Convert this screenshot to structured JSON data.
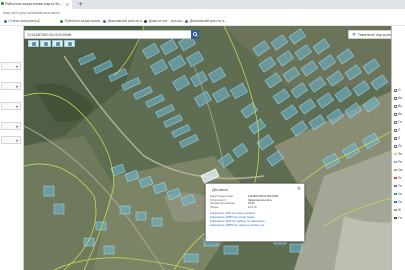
{
  "browser": {
    "tab_title": "Публічна кадастрова карта Ук...",
    "tab_close": "×",
    "new_tab": "+",
    "url": "map.land.gov.ua/kadastrova-karta"
  },
  "bookmarks": [
    {
      "label": "Стани конкуренції",
      "color": "#2a7ad1"
    },
    {
      "label": "Публічна кадастрова",
      "color": "#2c8a3a"
    },
    {
      "label": "Державний реєстр р...",
      "color": "#5e6b8a"
    },
    {
      "label": "Додати лот - аукціо...",
      "color": "#3f3f3f"
    },
    {
      "label": "Державний реєстр р...",
      "color": "#5e6b8a"
    }
  ],
  "search": {
    "value": "2124487300:01:003:0046"
  },
  "toolbar": {
    "layers_label": "Тематичні підгрупи"
  },
  "right_panel": {
    "items": [
      "О",
      "Ка",
      "Ву",
      "Ко",
      "Го",
      "П",
      "З",
      "Пс",
      "Зе",
      "Ре",
      "Ор",
      "Пг",
      "Та",
      "Ск",
      "Со",
      "Кі",
      "Ге"
    ]
  },
  "popup": {
    "title": "Ділянка",
    "close": "×",
    "rows": [
      {
        "key": "Кадастровий номер:",
        "value": "2124487300:01:003:0046"
      },
      {
        "key": "Тип власності:",
        "value": "Приватна власність"
      },
      {
        "key": "Цільове призначення:",
        "value": "01.03"
      },
      {
        "key": "Площа:",
        "value": "0.71 га"
      }
    ],
    "links": [
      "Інформація з ДЗК про оцінку ділянки",
      "Інформація з ДРРП про речові права",
      "Інформація з ДЗК про ділянку та обмеження",
      "Інформація з ДРРП про земельну ділянку (зі)"
    ]
  },
  "colors": {
    "parcel_fill": "#6fb8d3",
    "parcel_stroke": "#9fe0ff",
    "boundary_line": "#c8e65a",
    "popup_link": "#2a5ea8",
    "search_button": "#2f5d93"
  }
}
